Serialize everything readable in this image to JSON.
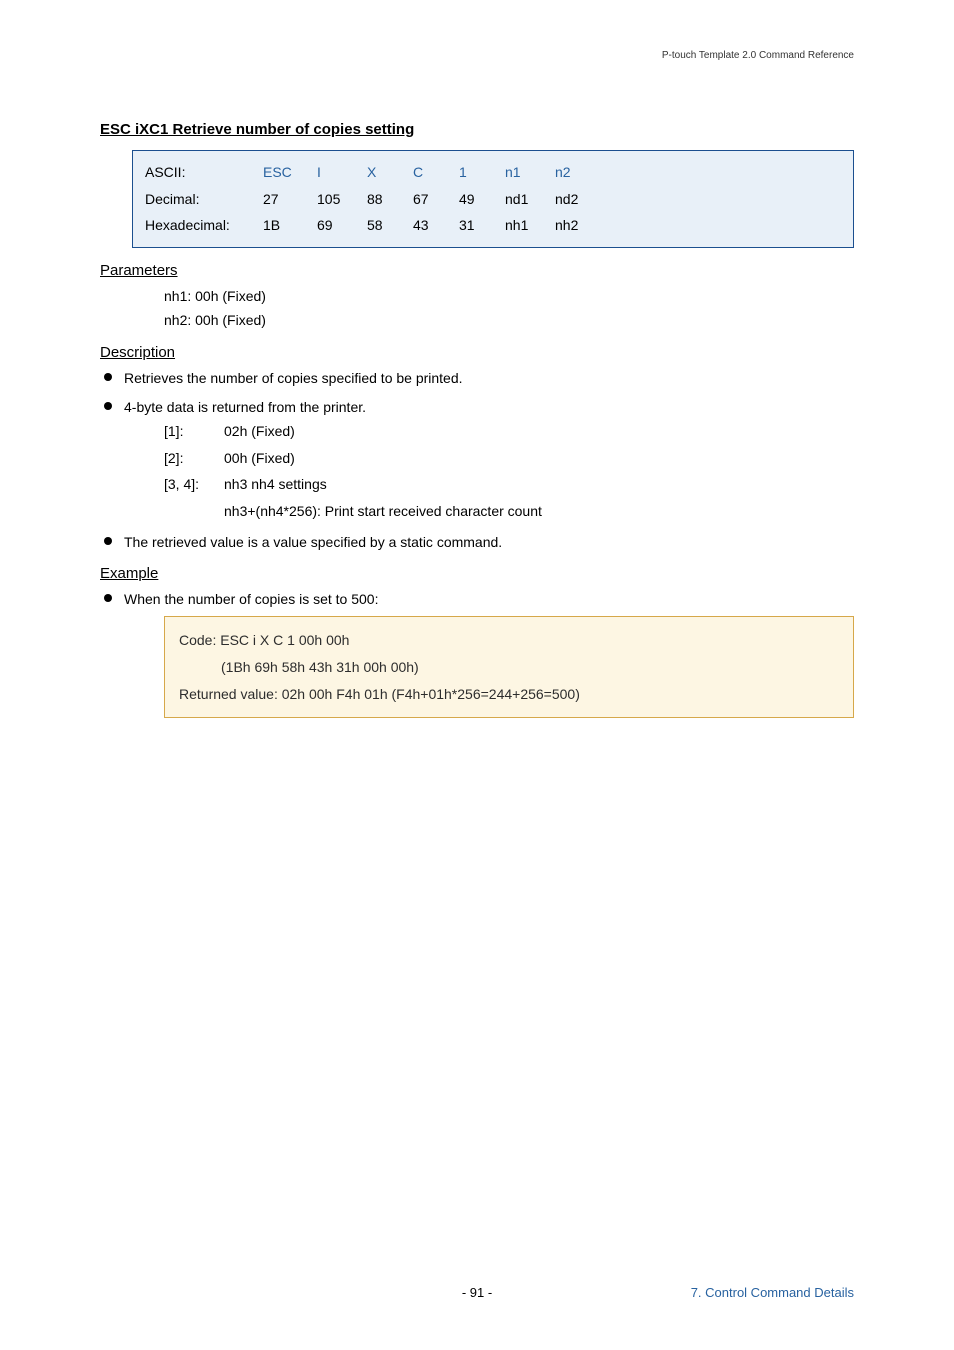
{
  "running_header": "P-touch Template 2.0 Command Reference",
  "section_title": "ESC iXC1   Retrieve number of copies setting",
  "code_table": {
    "rows": [
      {
        "label": "ASCII:",
        "cells": [
          "ESC",
          "I",
          "X",
          "C",
          "1",
          "n1",
          "n2"
        ],
        "blue": true
      },
      {
        "label": "Decimal:",
        "cells": [
          "27",
          "105",
          "88",
          "67",
          "49",
          "nd1",
          "nd2"
        ],
        "blue": false
      },
      {
        "label": "Hexadecimal:",
        "cells": [
          "1B",
          "69",
          "58",
          "43",
          "31",
          "nh1",
          "nh2"
        ],
        "blue": false
      }
    ]
  },
  "headings": {
    "parameters": "Parameters",
    "description": "Description",
    "example": "Example"
  },
  "parameters": [
    "nh1: 00h (Fixed)",
    "nh2: 00h (Fixed)"
  ],
  "description_bullets": [
    "Retrieves the number of copies specified to be printed.",
    "4-byte data is returned from the printer.",
    "The retrieved value is a value specified by a static command."
  ],
  "byte_defs": [
    {
      "key": "[1]:",
      "val": "02h (Fixed)"
    },
    {
      "key": "[2]:",
      "val": "00h (Fixed)"
    },
    {
      "key": "[3, 4]:",
      "val": "nh3 nh4 settings",
      "sub": "nh3+(nh4*256): Print start received character count"
    }
  ],
  "example_intro": "When the number of copies is set to 500:",
  "example_box": {
    "line1": "Code: ESC i X C 1 00h 00h",
    "line2": "(1Bh 69h 58h 43h 31h 00h 00h)",
    "line3": "Returned value: 02h 00h F4h 01h (F4h+01h*256=244+256=500)"
  },
  "page_number": "- 91 -",
  "footer_right": "7. Control Command Details"
}
